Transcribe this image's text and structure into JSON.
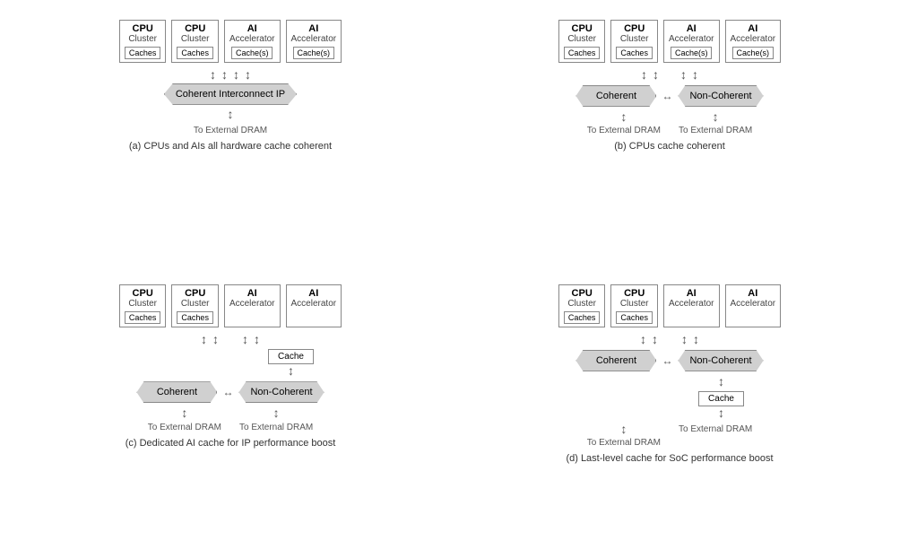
{
  "diagrams": [
    {
      "id": "a",
      "caption": "(a) CPUs and AIs all hardware cache coherent",
      "clusters": [
        {
          "type": "CPU",
          "sub": "Cluster",
          "cache": "Caches"
        },
        {
          "type": "CPU",
          "sub": "Cluster",
          "cache": "Caches"
        },
        {
          "type": "AI",
          "sub": "Accelerator",
          "cache": "Cache(s)"
        },
        {
          "type": "AI",
          "sub": "Accelerator",
          "cache": "Cache(s)"
        }
      ],
      "interconnect": "Coherent Interconnect IP",
      "dram": [
        "To External DRAM"
      ],
      "layout": "single-banner"
    },
    {
      "id": "b",
      "caption": "(b) CPUs cache coherent",
      "clusters": [
        {
          "type": "CPU",
          "sub": "Cluster",
          "cache": "Caches"
        },
        {
          "type": "CPU",
          "sub": "Cluster",
          "cache": "Caches"
        },
        {
          "type": "AI",
          "sub": "Accelerator",
          "cache": "Cache(s)"
        },
        {
          "type": "AI",
          "sub": "Accelerator",
          "cache": "Cache(s)"
        }
      ],
      "coherent": "Coherent",
      "noncoherent": "Non-Coherent",
      "dram": [
        "To External DRAM",
        "To External DRAM"
      ],
      "layout": "dual-banner"
    },
    {
      "id": "c",
      "caption": "(c) Dedicated AI cache for IP performance boost",
      "clusters": [
        {
          "type": "CPU",
          "sub": "Cluster",
          "cache": "Caches"
        },
        {
          "type": "CPU",
          "sub": "Cluster",
          "cache": "Caches"
        },
        {
          "type": "AI",
          "sub": "Accelerator",
          "cache": null
        },
        {
          "type": "AI",
          "sub": "Accelerator",
          "cache": null
        }
      ],
      "ai_cache": "Cache",
      "coherent": "Coherent",
      "noncoherent": "Non-Coherent",
      "dram": [
        "To External DRAM",
        "To External DRAM"
      ],
      "layout": "c-layout"
    },
    {
      "id": "d",
      "caption": "(d) Last-level cache for SoC performance boost",
      "clusters": [
        {
          "type": "CPU",
          "sub": "Cluster",
          "cache": "Caches"
        },
        {
          "type": "CPU",
          "sub": "Cluster",
          "cache": "Caches"
        },
        {
          "type": "AI",
          "sub": "Accelerator",
          "cache": null
        },
        {
          "type": "AI",
          "sub": "Accelerator",
          "cache": null
        }
      ],
      "llc": "Cache",
      "coherent": "Coherent",
      "noncoherent": "Non-Coherent",
      "dram": [
        "To External DRAM",
        "To External DRAM"
      ],
      "layout": "d-layout"
    }
  ]
}
